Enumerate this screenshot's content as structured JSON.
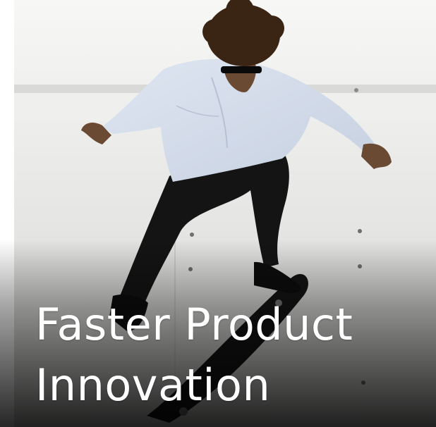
{
  "hero": {
    "title_lines": [
      "Faster Product",
      "Innovation"
    ],
    "image": "skateboarder doing a kickflip in front of a white wall"
  },
  "colors": {
    "title_text": "#ffffff",
    "background": "#ffffff",
    "wall": "#e9e9e9",
    "overlay_dark": "#111111"
  }
}
